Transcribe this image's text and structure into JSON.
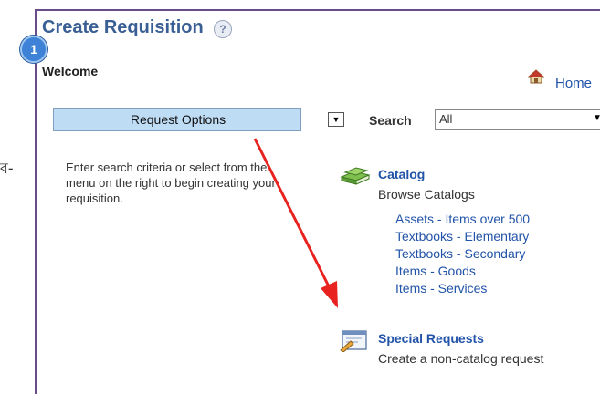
{
  "page": {
    "title": "Create Requisition",
    "help_glyph": "?",
    "step_number": "1",
    "welcome": "Welcome",
    "left_fragment": "ব-"
  },
  "header": {
    "home_label": "Home"
  },
  "toolbar": {
    "request_options_label": "Request Options",
    "search_label": "Search",
    "search_value": "All"
  },
  "instructions": "Enter search criteria or select from the menu on the right to begin creating your requisition.",
  "catalog": {
    "title": "Catalog",
    "subtitle": "Browse Catalogs",
    "items": [
      "Assets - Items over 500",
      "Textbooks - Elementary",
      "Textbooks - Secondary",
      "Items - Goods",
      "Items - Services"
    ]
  },
  "special": {
    "title": "Special Requests",
    "subtitle": "Create a non-catalog request"
  },
  "colors": {
    "link": "#2153a8",
    "title": "#3a5f94",
    "frame": "#6b4c8a",
    "arrow": "#e8231f",
    "options_bg": "#bfdcf5"
  }
}
